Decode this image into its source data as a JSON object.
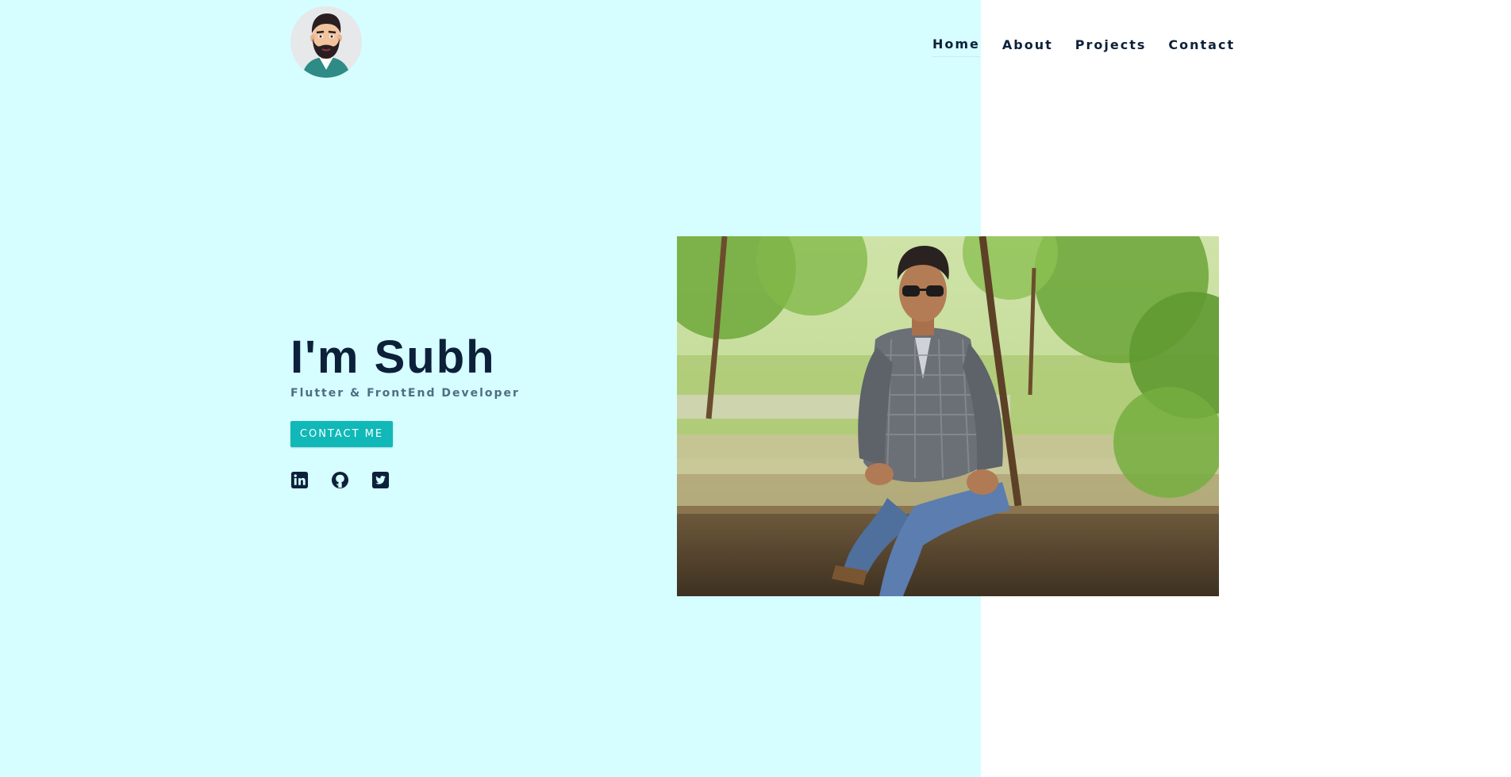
{
  "header": {
    "logo_icon": "avatar-icon",
    "nav": [
      {
        "label": "Home",
        "active": true
      },
      {
        "label": "About",
        "active": false
      },
      {
        "label": "Projects",
        "active": false
      },
      {
        "label": "Contact",
        "active": false
      }
    ]
  },
  "hero": {
    "title": "I'm Subh",
    "subtitle": "Flutter & FrontEnd Developer",
    "cta_label": "CONTACT ME",
    "socials": [
      {
        "icon": "linkedin-icon"
      },
      {
        "icon": "github-icon"
      },
      {
        "icon": "twitter-icon"
      }
    ],
    "photo_icon": "profile-photo"
  },
  "colors": {
    "left_background": "#d6fdff",
    "right_background": "#ffffff",
    "text_dark": "#0c2139",
    "subtitle": "#4e6d85",
    "accent": "#10b8b8"
  }
}
